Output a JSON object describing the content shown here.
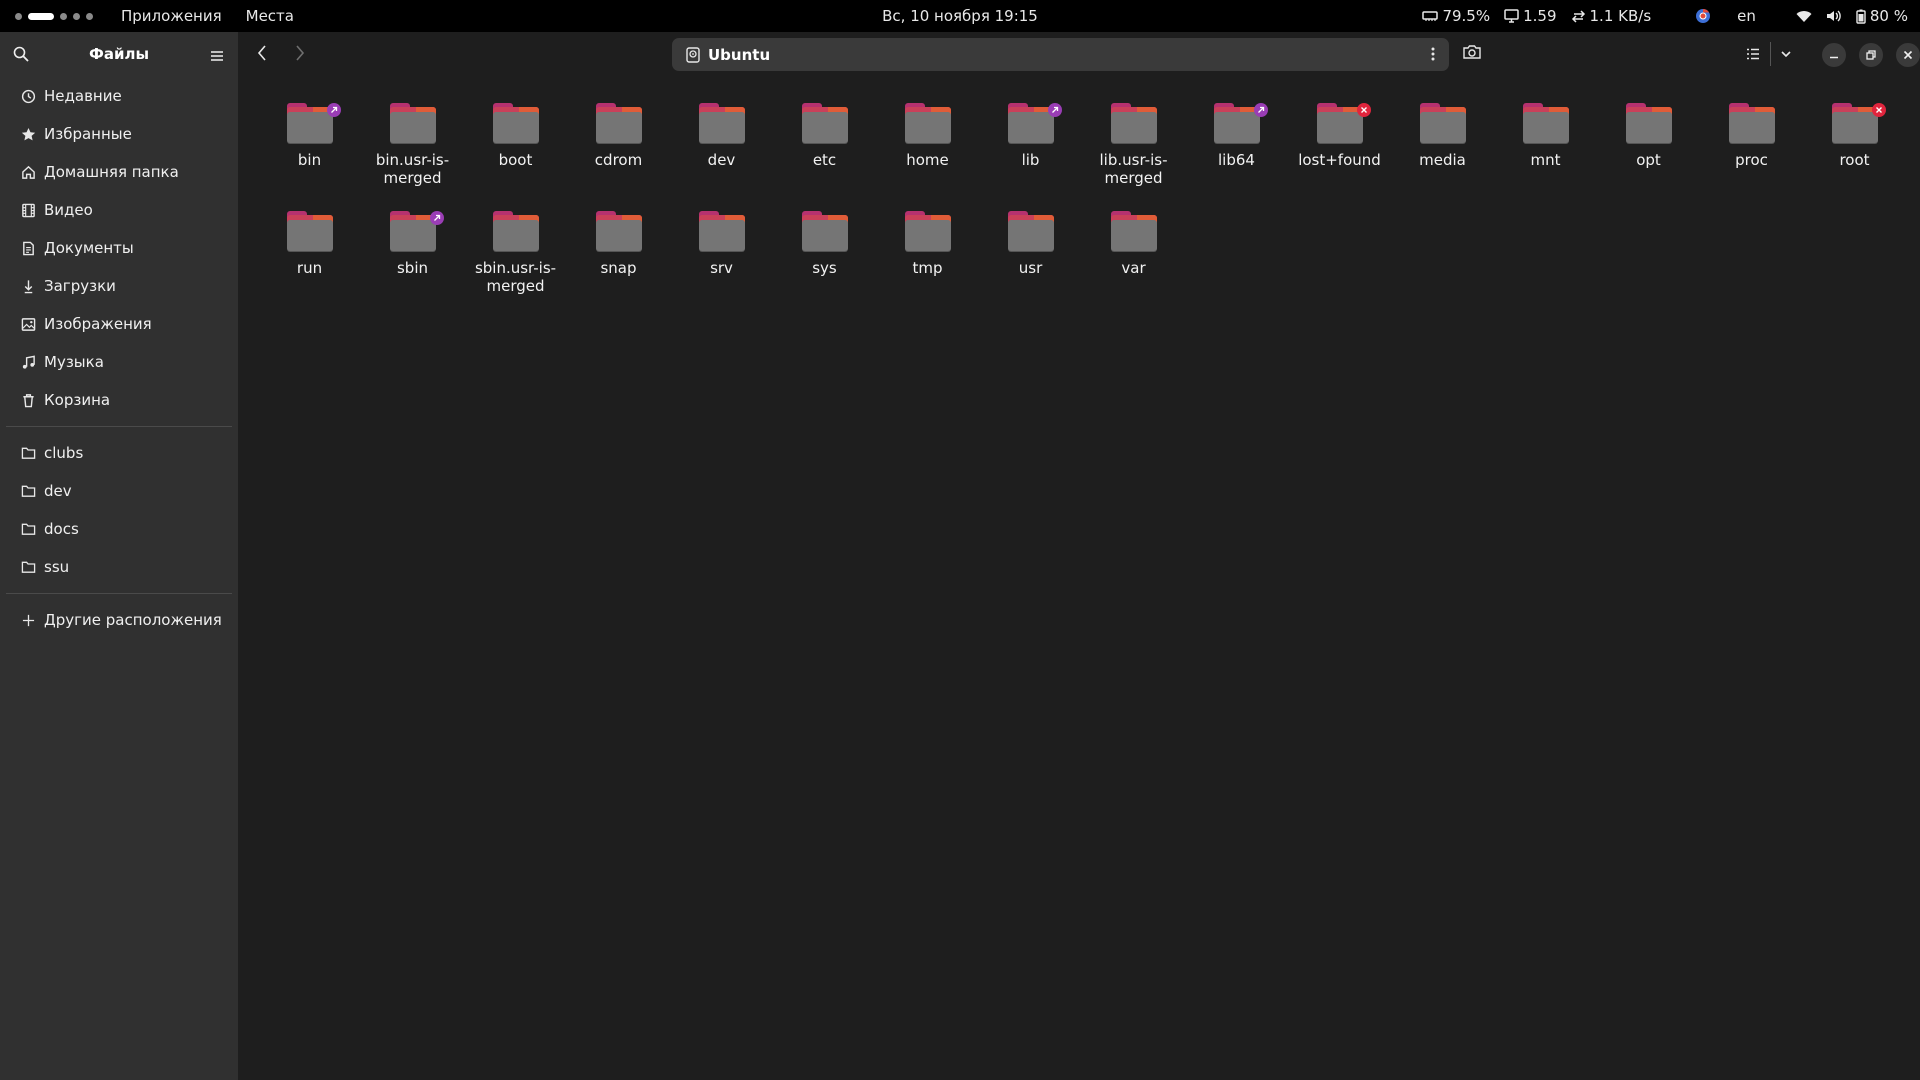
{
  "topbar": {
    "menu": [
      "Приложения",
      "Места"
    ],
    "clock": "Вс, 10 ноября  19:15",
    "mem": "79.5%",
    "load": "1.59",
    "net": "1.1 KB/s",
    "lang": "en",
    "battery": "80 %"
  },
  "sidebar": {
    "title": "Файлы",
    "places": [
      {
        "label": "Недавние",
        "icon": "clock-icon"
      },
      {
        "label": "Избранные",
        "icon": "star-icon"
      },
      {
        "label": "Домашняя папка",
        "icon": "home-icon"
      },
      {
        "label": "Видео",
        "icon": "film-icon"
      },
      {
        "label": "Документы",
        "icon": "document-icon"
      },
      {
        "label": "Загрузки",
        "icon": "download-icon"
      },
      {
        "label": "Изображения",
        "icon": "image-icon"
      },
      {
        "label": "Музыка",
        "icon": "music-icon"
      },
      {
        "label": "Корзина",
        "icon": "trash-icon"
      }
    ],
    "bookmarks": [
      {
        "label": "clubs",
        "icon": "folder-icon"
      },
      {
        "label": "dev",
        "icon": "folder-icon"
      },
      {
        "label": "docs",
        "icon": "folder-icon"
      },
      {
        "label": "ssu",
        "icon": "folder-icon"
      }
    ],
    "other": {
      "label": "Другие расположения",
      "icon": "plus-icon"
    }
  },
  "header": {
    "path": "Ubuntu"
  },
  "files": [
    {
      "name": "bin",
      "emblem": "link"
    },
    {
      "name": "bin.usr-is-merged",
      "emblem": ""
    },
    {
      "name": "boot",
      "emblem": ""
    },
    {
      "name": "cdrom",
      "emblem": ""
    },
    {
      "name": "dev",
      "emblem": ""
    },
    {
      "name": "etc",
      "emblem": ""
    },
    {
      "name": "home",
      "emblem": ""
    },
    {
      "name": "lib",
      "emblem": "link"
    },
    {
      "name": "lib.usr-is-merged",
      "emblem": ""
    },
    {
      "name": "lib64",
      "emblem": "link"
    },
    {
      "name": "lost+found",
      "emblem": "lock"
    },
    {
      "name": "media",
      "emblem": ""
    },
    {
      "name": "mnt",
      "emblem": ""
    },
    {
      "name": "opt",
      "emblem": ""
    },
    {
      "name": "proc",
      "emblem": ""
    },
    {
      "name": "root",
      "emblem": "lock"
    },
    {
      "name": "run",
      "emblem": ""
    },
    {
      "name": "sbin",
      "emblem": "link"
    },
    {
      "name": "sbin.usr-is-merged",
      "emblem": ""
    },
    {
      "name": "snap",
      "emblem": ""
    },
    {
      "name": "srv",
      "emblem": ""
    },
    {
      "name": "sys",
      "emblem": ""
    },
    {
      "name": "tmp",
      "emblem": ""
    },
    {
      "name": "usr",
      "emblem": ""
    },
    {
      "name": "var",
      "emblem": ""
    }
  ]
}
